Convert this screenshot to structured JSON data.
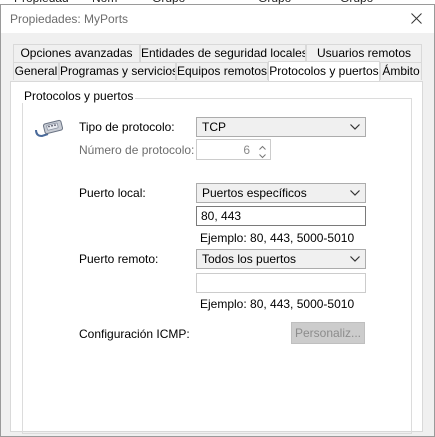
{
  "window": {
    "title": "Propiedades: MyPorts",
    "close_icon": "close-icon"
  },
  "tabs_row1": [
    {
      "label": "Opciones avanzadas"
    },
    {
      "label": "Entidades de seguridad locales"
    },
    {
      "label": "Usuarios remotos"
    }
  ],
  "tabs_row2": [
    {
      "label": "General"
    },
    {
      "label": "Programas y servicios"
    },
    {
      "label": "Equipos remotos"
    },
    {
      "label": "Protocolos y puertos"
    },
    {
      "label": "Ámbito"
    }
  ],
  "active_tab": "Protocolos y puertos",
  "group": {
    "title": "Protocolos y puertos",
    "icon": "network-cable-icon"
  },
  "protocol": {
    "type_label": "Tipo de protocolo:",
    "type_value": "TCP",
    "number_label": "Número de protocolo:",
    "number_value": "6"
  },
  "local_port": {
    "label": "Puerto local:",
    "select_value": "Puertos específicos",
    "input_value": "80, 443",
    "example": "Ejemplo: 80, 443, 5000-5010"
  },
  "remote_port": {
    "label": "Puerto remoto:",
    "select_value": "Todos los puertos",
    "input_value": "",
    "example": "Ejemplo: 80, 443, 5000-5010"
  },
  "icmp": {
    "label": "Configuración ICMP:",
    "button_label": "Personaliz..."
  }
}
